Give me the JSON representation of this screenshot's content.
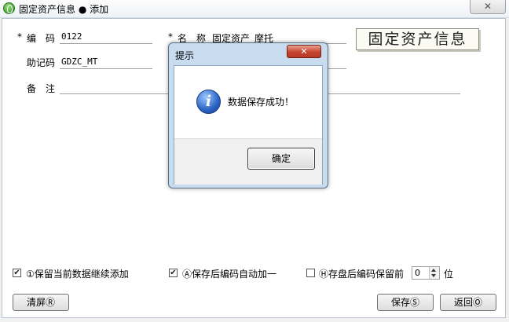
{
  "window": {
    "title": "固定资产信息 ● 添加",
    "close_label": "✕"
  },
  "form": {
    "code_label": "编　码",
    "code_value": "0122",
    "name_label": "名　称",
    "name_value": "固定资产_摩托",
    "mnemonic_label": "助记码",
    "mnemonic_value": "GDZC_MT",
    "remark_label": "备　注",
    "remark_value": "",
    "required_mark": "*",
    "stamp_text": "固定资产信息"
  },
  "options": {
    "keep_data": {
      "label": "①保留当前数据继续添加",
      "checked": true
    },
    "auto_increment": {
      "label": "Ⓐ保存后编码自动加一",
      "checked": true
    },
    "keep_code_prefix": {
      "label": "Ⓗ存盘后编码保留前",
      "checked": false
    },
    "prefix_digits": "0",
    "prefix_unit": "位"
  },
  "buttons": {
    "clear_label": "清屏Ⓡ",
    "save_label": "保存Ⓢ",
    "back_label": "返回Ⓞ"
  },
  "dialog": {
    "title": "提示",
    "close_label": "✕",
    "message": "数据保存成功！",
    "ok_label": "确定",
    "icon": "info-icon"
  }
}
